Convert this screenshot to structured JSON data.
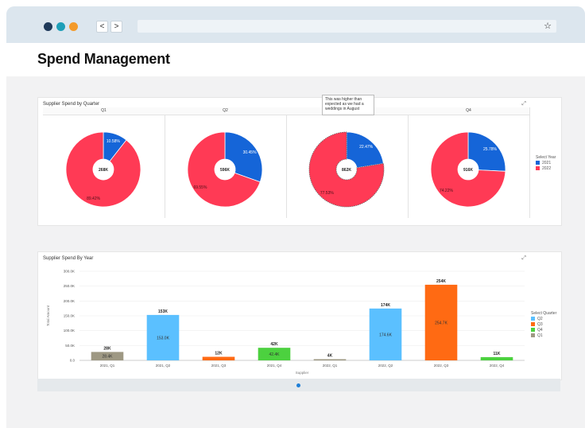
{
  "page": {
    "title": "Spend Management"
  },
  "browser": {
    "dots": [
      {
        "name": "dot-dark-icon",
        "color": "#1f3a5a"
      },
      {
        "name": "dot-teal-icon",
        "color": "#1e9fb8"
      },
      {
        "name": "dot-orange-icon",
        "color": "#f39a2a"
      }
    ],
    "back": "<",
    "forward": ">",
    "star": "☆"
  },
  "quarter_chart": {
    "title": "Supplier Spend by Quarter",
    "quarters": [
      "Q1",
      "Q2",
      "Q3",
      "Q4"
    ],
    "legend_title": "Select Year",
    "legend": [
      {
        "label": "2021",
        "color": "#1565d8"
      },
      {
        "label": "2022",
        "color": "#ff3a55"
      }
    ],
    "tooltip": "This was higher than expected as we had a weddings in August"
  },
  "year_chart": {
    "title": "Supplier Spend By Year",
    "xlabel": "Supplier",
    "ylabel": "Total Amount",
    "legend_title": "Select Quarter",
    "legend": [
      {
        "label": "Q2",
        "color": "#5bc0ff"
      },
      {
        "label": "Q3",
        "color": "#ff6a13"
      },
      {
        "label": "Q4",
        "color": "#4cd13f"
      },
      {
        "label": "Q1",
        "color": "#9e9883"
      }
    ]
  },
  "chart_data": [
    {
      "type": "pie",
      "title": "Supplier Spend by Quarter",
      "donut": true,
      "facets": [
        "Q1",
        "Q2",
        "Q3",
        "Q4"
      ],
      "series_names": [
        "2021",
        "2022"
      ],
      "colors": [
        "#1565d8",
        "#ff3a55"
      ],
      "totals": [
        "268K",
        "596K",
        "862K",
        "916K"
      ],
      "values": [
        [
          10.58,
          89.42
        ],
        [
          30.45,
          69.55
        ],
        [
          22.47,
          77.53
        ],
        [
          25.78,
          74.22
        ]
      ],
      "labels": [
        [
          "10.58%",
          "89.42%"
        ],
        [
          "30.45%",
          "69.55%"
        ],
        [
          "22.47%",
          "77.53%"
        ],
        [
          "25.78%",
          "74.22%"
        ]
      ],
      "legend": "right"
    },
    {
      "type": "bar",
      "title": "Supplier Spend By Year",
      "xlabel": "Supplier",
      "ylabel": "Total Amount",
      "categories": [
        "2021, Q1",
        "2021, Q2",
        "2021, Q3",
        "2021, Q4",
        "2022, Q1",
        "2022, Q2",
        "2022, Q3",
        "2022, Q4"
      ],
      "values": [
        28.4,
        153.0,
        12,
        42.4,
        4,
        174.6,
        254.7,
        11
      ],
      "quarter": [
        "Q1",
        "Q2",
        "Q3",
        "Q4",
        "Q1",
        "Q2",
        "Q3",
        "Q4"
      ],
      "top_labels": [
        "28K",
        "153K",
        "12K",
        "42K",
        "4K",
        "174K",
        "254K",
        "11K"
      ],
      "inner_labels": [
        "28.4K",
        "153.0K",
        "",
        "42.4K",
        "",
        "174.6K",
        "254.7K",
        ""
      ],
      "yticks": [
        "0.0",
        "50.0K",
        "100.0K",
        "150.0K",
        "200.0K",
        "250.0K",
        "300.0K"
      ],
      "ylim": [
        0,
        300
      ],
      "grid": true,
      "legend": "right"
    }
  ]
}
